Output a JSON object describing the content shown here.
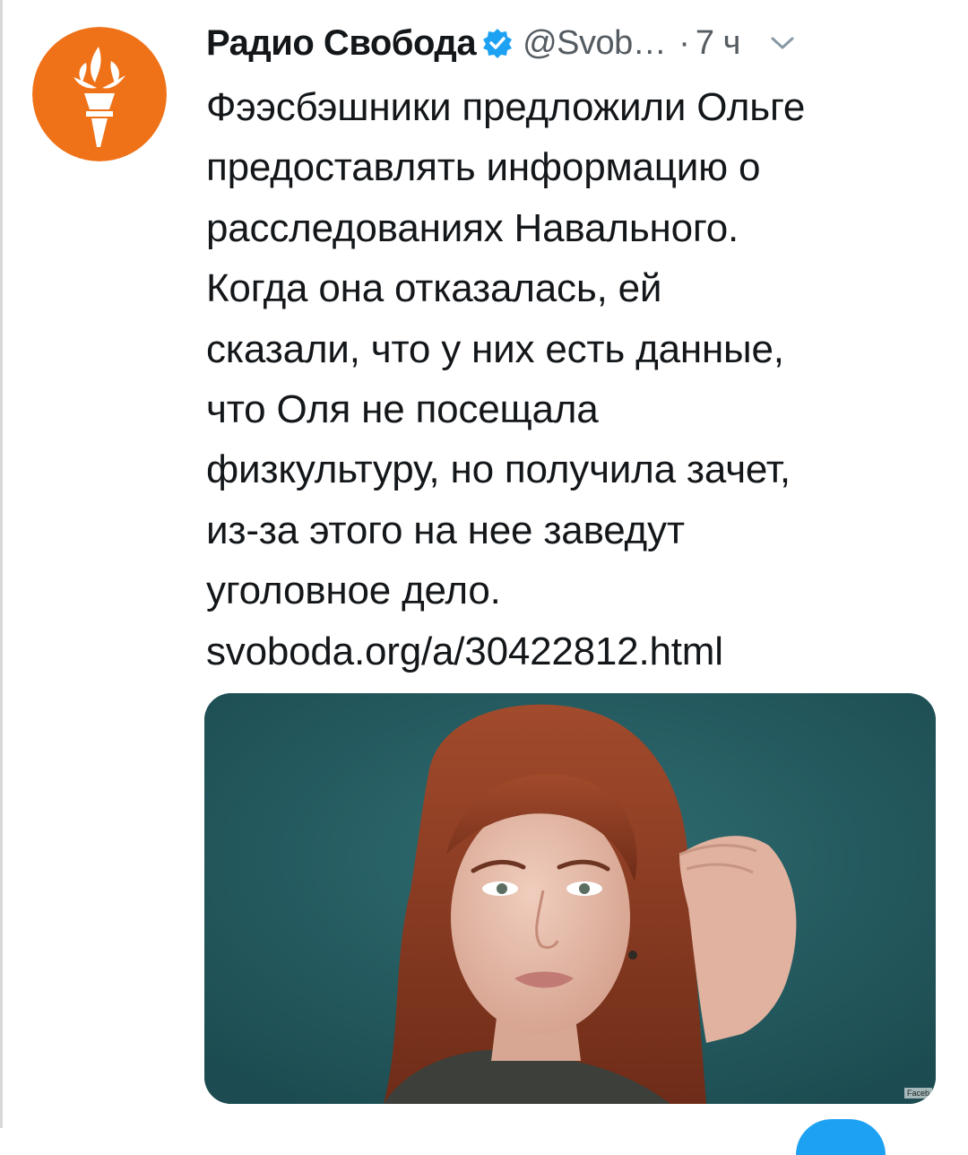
{
  "tweet": {
    "author": {
      "display_name": "Радио Свобода",
      "handle": "@Svob…",
      "verified": true,
      "avatar_icon": "torch-logo-icon",
      "avatar_color": "#ef7219"
    },
    "separator": "·",
    "time": "7 ч",
    "menu_icon": "chevron-down-icon",
    "verified_icon": "verified-badge-icon",
    "verified_color": "#1da1f2",
    "text_lines": [
      "Фээсбэшники предложили Ольге",
      "предоставлять информацию о",
      "расследованиях Навального.",
      "Когда она  отказалась, ей",
      "сказали, что у них есть данные,",
      "что Оля не посещала",
      "физкультуру, но получила зачет,",
      "из-за этого на нее заведут",
      "уголовное дело."
    ],
    "link": "svoboda.org/a/30422812.html",
    "media": {
      "watermark": "Faceb"
    }
  },
  "fab_color": "#1da1f2"
}
